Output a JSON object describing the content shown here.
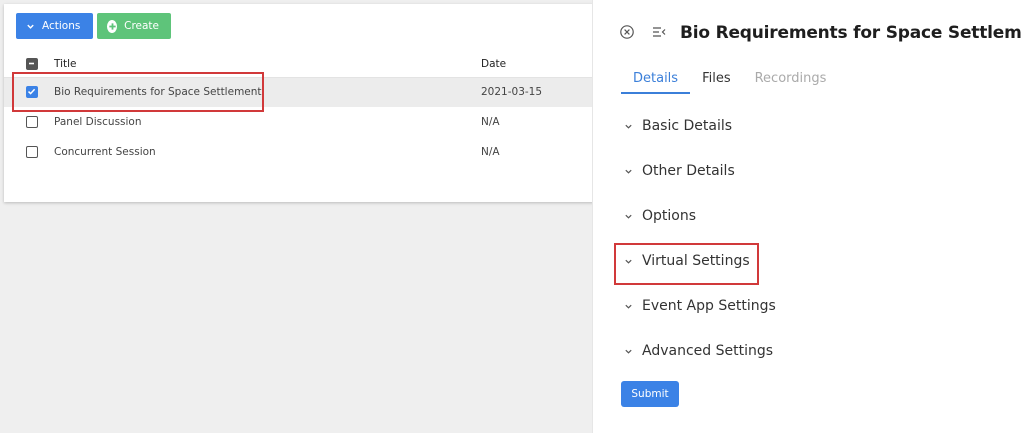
{
  "toolbar": {
    "actions_label": "Actions",
    "create_label": "Create"
  },
  "table": {
    "columns": [
      "Title",
      "Date"
    ],
    "rows": [
      {
        "title": "Bio Requirements for Space Settlement",
        "date": "2021-03-15",
        "checked": true
      },
      {
        "title": "Panel Discussion",
        "date": "N/A",
        "checked": false
      },
      {
        "title": "Concurrent Session",
        "date": "N/A",
        "checked": false
      }
    ]
  },
  "panel": {
    "title": "Bio Requirements for Space Settlement",
    "tabs": [
      {
        "label": "Details",
        "state": "active"
      },
      {
        "label": "Files",
        "state": "normal"
      },
      {
        "label": "Recordings",
        "state": "disabled"
      }
    ],
    "sections": [
      "Basic Details",
      "Other Details",
      "Options",
      "Virtual Settings",
      "Event App Settings",
      "Advanced Settings"
    ],
    "submit_label": "Submit"
  },
  "icons": {
    "close": "close-circle-icon",
    "collapse": "collapse-panel-icon",
    "chevron": "chevron-down-icon",
    "plus": "plus-circle-icon",
    "drag": "drag-handle-icon",
    "check": "checkmark-icon"
  },
  "colors": {
    "primary": "#3b82e6",
    "create": "#5ec47a",
    "highlight": "#d1393a",
    "selected_row": "#ececec"
  }
}
